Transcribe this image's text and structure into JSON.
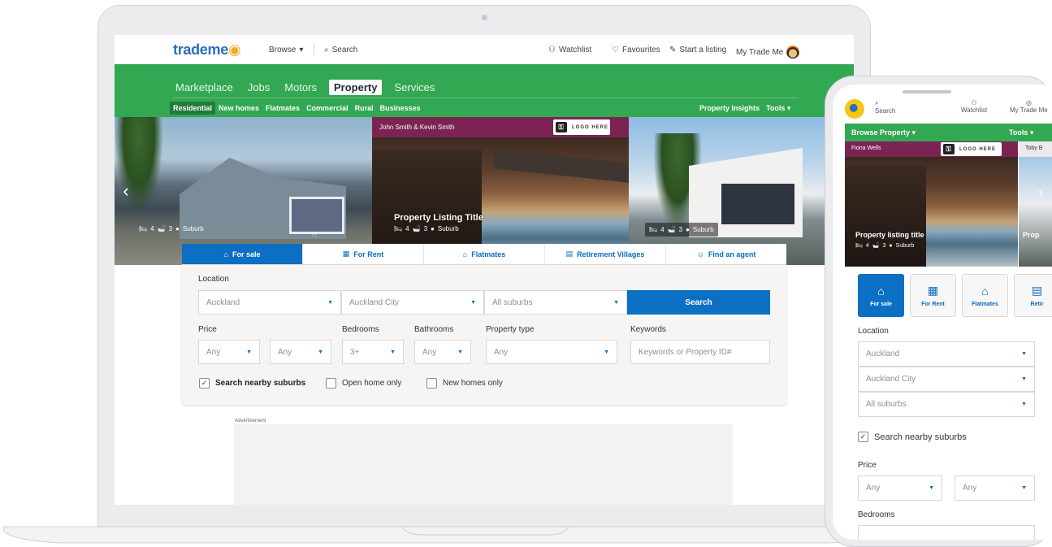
{
  "laptop": {
    "topbar": {
      "logo": "trademe",
      "browse": "Browse",
      "search": "Search",
      "watchlist": "Watchlist",
      "favourites": "Favourites",
      "start_listing": "Start a listing",
      "my_trade_me": "My Trade Me"
    },
    "nav_primary": [
      "Marketplace",
      "Jobs",
      "Motors",
      "Property",
      "Services"
    ],
    "nav_primary_active": "Property",
    "nav_secondary": [
      "Residential",
      "New homes",
      "Flatmates",
      "Commercial",
      "Rural",
      "Businesses"
    ],
    "nav_secondary_active": "Residential",
    "property_insights": "Property Insights",
    "tools": "Tools",
    "hero": {
      "agent_name": "John Smith & Kevin Smith",
      "logo_here": "LOGO HERE",
      "listing_title": "Property Listing Title",
      "slides": [
        {
          "beds": "4",
          "baths": "3",
          "suburb": "Suburb"
        },
        {
          "beds": "4",
          "baths": "3",
          "suburb": "Suburb"
        },
        {
          "beds": "4",
          "baths": "3",
          "suburb": "Suburb"
        }
      ]
    },
    "tabs": [
      "For sale",
      "For Rent",
      "Flatmates",
      "Retirement Villages",
      "Find an agent"
    ],
    "tabs_active": "For sale",
    "search": {
      "location_label": "Location",
      "region": "Auckland",
      "district": "Auckland City",
      "suburbs": "All suburbs",
      "search_button": "Search",
      "price_label": "Price",
      "price_min": "Any",
      "price_max": "Any",
      "bedrooms_label": "Bedrooms",
      "bedrooms": "3+",
      "bathrooms_label": "Bathrooms",
      "bathrooms": "Any",
      "property_type_label": "Property type",
      "property_type": "Any",
      "keywords_label": "Keywords",
      "keywords_placeholder": "Keywords or Property ID#",
      "nearby": "Search nearby suburbs",
      "nearby_checked": true,
      "open_home": "Open home only",
      "new_homes": "New homes only"
    },
    "advertisement": "Advertisement"
  },
  "phone": {
    "search": "Search",
    "watchlist": "Watchlist",
    "my_trade_me": "My Trade Me",
    "browse_property": "Browse Property",
    "tools": "Tools",
    "agent_name": "Fiona Wells",
    "logo_here": "LOGO HERE",
    "agent_name_2": "Toby B",
    "listing_title": "Property listing title",
    "listing_title_2": "Prop",
    "beds": "4",
    "baths": "3",
    "suburb": "Suburb",
    "tiles": [
      "For sale",
      "For Rent",
      "Flatmates",
      "Retir"
    ],
    "location_label": "Location",
    "region": "Auckland",
    "district": "Auckland City",
    "suburbs": "All suburbs",
    "nearby": "Search nearby suburbs",
    "price_label": "Price",
    "price_min": "Any",
    "price_max": "Any",
    "bedrooms_label": "Bedrooms"
  },
  "colors": {
    "green": "#33a852",
    "blue": "#0b6fc4",
    "agent_purple": "#7b2454"
  }
}
